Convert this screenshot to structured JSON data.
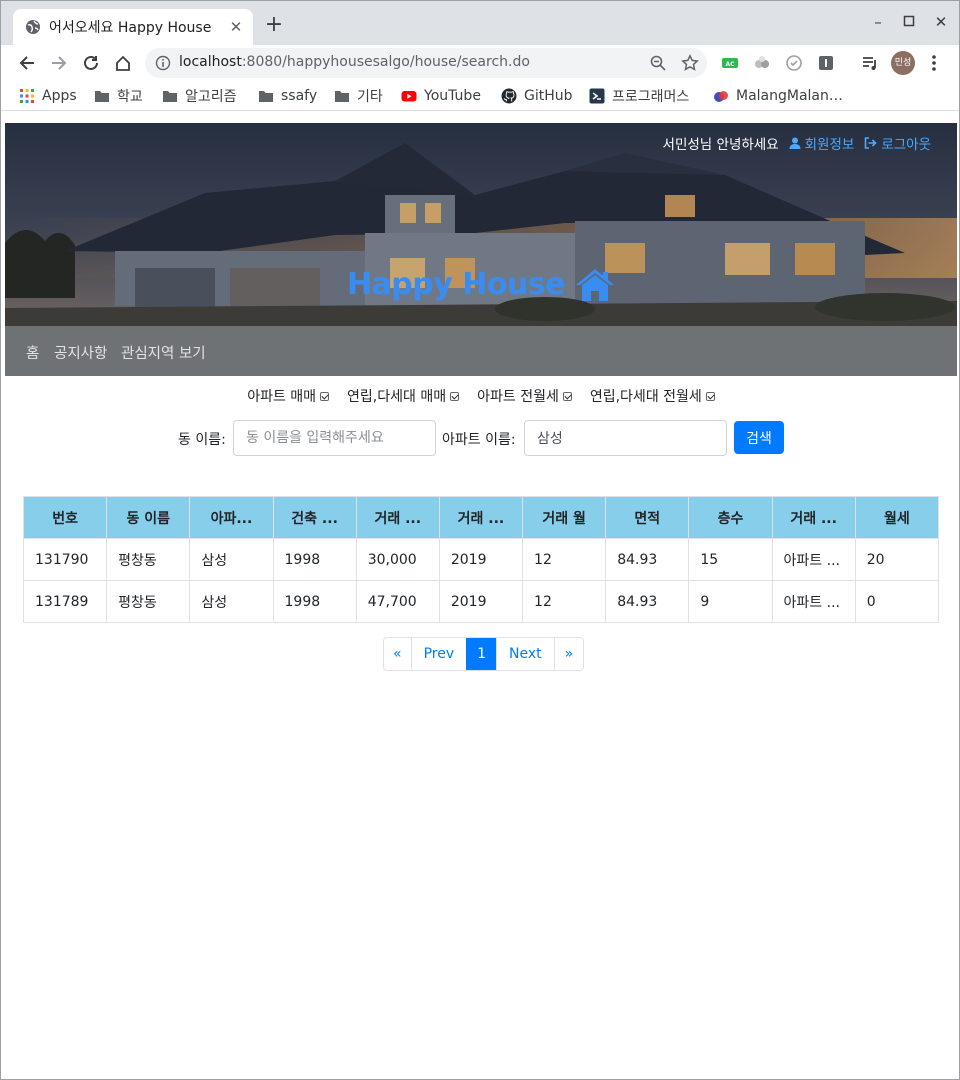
{
  "browser": {
    "tab_title": "어서오세요 Happy House",
    "url_host": "localhost",
    "url_rest": ":8080/happyhousesalgo/house/search.do",
    "profile_label": "민성",
    "bookmarks": [
      {
        "label": "Apps",
        "icon": "apps-grid-icon"
      },
      {
        "label": "학교",
        "icon": "folder-icon"
      },
      {
        "label": "알고리즘",
        "icon": "folder-icon"
      },
      {
        "label": "ssafy",
        "icon": "folder-icon"
      },
      {
        "label": "기타",
        "icon": "folder-icon"
      },
      {
        "label": "YouTube",
        "icon": "youtube-icon"
      },
      {
        "label": "GitHub",
        "icon": "github-icon"
      },
      {
        "label": "프로그래머스",
        "icon": "programmers-icon"
      },
      {
        "label": "MalangMalan…",
        "icon": "malang-icon"
      }
    ]
  },
  "header": {
    "greeting": "서민성님 안녕하세요",
    "member_info": "회원정보",
    "logout": "로그아웃",
    "brand": "Happy House"
  },
  "nav": {
    "items": [
      "홈",
      "공지사항",
      "관심지역 보기"
    ]
  },
  "filters": [
    {
      "label": "아파트 매매",
      "checked": true
    },
    {
      "label": "연립,다세대 매매",
      "checked": true
    },
    {
      "label": "아파트 전월세",
      "checked": true
    },
    {
      "label": "연립,다세대 전월세",
      "checked": true
    }
  ],
  "search": {
    "dong_label": "동 이름:",
    "dong_placeholder": "동 이름을 입력해주세요",
    "dong_value": "",
    "apt_label": "아파트 이름:",
    "apt_value": "삼성",
    "button": "검색"
  },
  "table": {
    "headers": [
      "번호",
      "동 이름",
      "아파...",
      "건축 ...",
      "거래 ...",
      "거래 ...",
      "거래 월",
      "면적",
      "층수",
      "거래 ...",
      "월세"
    ],
    "rows": [
      [
        "131790",
        "평창동",
        "삼성",
        "1998",
        "30,000",
        "2019",
        "12",
        "84.93",
        "15",
        "아파트 ...",
        "20"
      ],
      [
        "131789",
        "평창동",
        "삼성",
        "1998",
        "47,700",
        "2019",
        "12",
        "84.93",
        "9",
        "아파트 ...",
        "0"
      ]
    ]
  },
  "pagination": {
    "first": "«",
    "prev": "Prev",
    "current": "1",
    "next": "Next",
    "last": "»"
  },
  "colors": {
    "header_bg": "#87ceeb",
    "primary": "#007bff",
    "brand": "#3a8df0",
    "navbar": "#6e7275"
  }
}
